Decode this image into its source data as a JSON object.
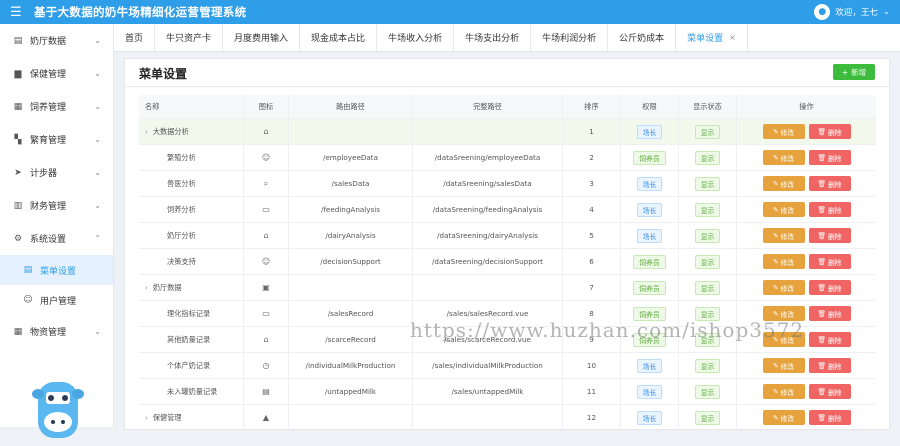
{
  "header": {
    "title": "基于大数据的奶牛场精细化运营管理系统",
    "user_label": "欢迎，王七",
    "menu_icon": "hamburger-icon"
  },
  "sidebar": {
    "items": [
      {
        "label": "奶厅数据",
        "icon": "table-icon"
      },
      {
        "label": "保健管理",
        "icon": "briefcase-icon"
      },
      {
        "label": "饲养管理",
        "icon": "grid-icon"
      },
      {
        "label": "繁育管理",
        "icon": "blocks-icon"
      },
      {
        "label": "计步器",
        "icon": "send-icon"
      },
      {
        "label": "财务管理",
        "icon": "ledger-icon"
      },
      {
        "label": "系统设置",
        "icon": "gear-icon"
      },
      {
        "label": "菜单设置",
        "icon": "menu-icon"
      },
      {
        "label": "用户管理",
        "icon": "user-icon"
      },
      {
        "label": "物资管理",
        "icon": "grid-icon"
      }
    ]
  },
  "tabs": [
    "首页",
    "牛只资产卡",
    "月度费用输入",
    "现金成本占比",
    "牛场收入分析",
    "牛场支出分析",
    "牛场利润分析",
    "公斤奶成本",
    "菜单设置"
  ],
  "page": {
    "title": "菜单设置",
    "add_label": "新增"
  },
  "table": {
    "headers": [
      "名称",
      "图标",
      "路由路径",
      "完整路径",
      "排序",
      "权限",
      "显示状态",
      "操作"
    ],
    "edit_label": "修改",
    "delete_label": "删除",
    "rows": [
      {
        "name": "大数据分析",
        "icon": "⌂",
        "route": "",
        "path": "",
        "order": "1",
        "perm": "场长",
        "status": "显示"
      },
      {
        "name": "繁殖分析",
        "icon": "☺",
        "route": "/employeeData",
        "path": "/dataSreening/employeeData",
        "order": "2",
        "perm": "饲养员",
        "status": "显示"
      },
      {
        "name": "兽医分析",
        "icon": "⌕",
        "route": "/salesData",
        "path": "/dataSreening/salesData",
        "order": "3",
        "perm": "场长",
        "status": "显示"
      },
      {
        "name": "饲养分析",
        "icon": "▭",
        "route": "/feedingAnalysis",
        "path": "/dataSreening/feedingAnalysis",
        "order": "4",
        "perm": "场长",
        "status": "显示"
      },
      {
        "name": "奶厅分析",
        "icon": "⌂",
        "route": "/dairyAnalysis",
        "path": "/dataSreening/dairyAnalysis",
        "order": "5",
        "perm": "场长",
        "status": "显示"
      },
      {
        "name": "决策支持",
        "icon": "☺",
        "route": "/decisionSupport",
        "path": "/dataSreening/decisionSupport",
        "order": "6",
        "perm": "饲养员",
        "status": "显示"
      },
      {
        "name": "奶厅数据",
        "icon": "▣",
        "route": "",
        "path": "",
        "order": "7",
        "perm": "饲养员",
        "status": "显示"
      },
      {
        "name": "理化指标记录",
        "icon": "▭",
        "route": "/salesRecord",
        "path": "/sales/salesRecord.vue",
        "order": "8",
        "perm": "饲养员",
        "status": "显示"
      },
      {
        "name": "其他奶量记录",
        "icon": "⌂",
        "route": "/scarceRecord",
        "path": "/sales/scarceRecord.vue",
        "order": "9",
        "perm": "饲养员",
        "status": "显示"
      },
      {
        "name": "个体产奶记录",
        "icon": "◷",
        "route": "/individualMilkProduction",
        "path": "/sales/individualMilkProduction",
        "order": "10",
        "perm": "场长",
        "status": "显示"
      },
      {
        "name": "未入罐奶量记录",
        "icon": "▤",
        "route": "/untappedMilk",
        "path": "/sales/untappedMilk",
        "order": "11",
        "perm": "场长",
        "status": "显示"
      },
      {
        "name": "保健管理",
        "icon": "▲",
        "route": "",
        "path": "",
        "order": "12",
        "perm": "场长",
        "status": "显示"
      }
    ]
  },
  "watermark": "https://www.huzhan.com/ishop3572",
  "colors": {
    "primary": "#2f9ee8",
    "add": "#3dbb3d",
    "edit": "#e6a23c",
    "delete": "#f06464"
  }
}
